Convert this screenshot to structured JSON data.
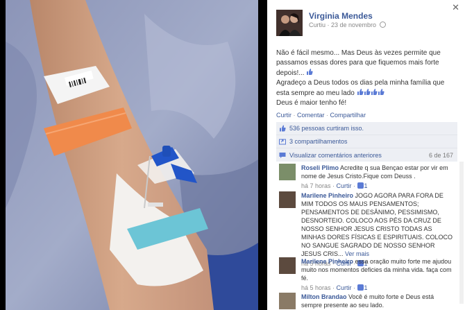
{
  "post": {
    "author": "Virginia Mendes",
    "meta": "Curtiu · 23 de novembro",
    "lines": [
      "Não é fácil mesmo... Mas Deus às vezes permite que passamos essas dores para que fiquemos mais forte depois!...",
      "Agradeço a Deus todos os dias pela minha família que esta sempre ao meu lado",
      "Deus é maior tenho fé!"
    ],
    "actions": {
      "like": "Curtir",
      "comment": "Comentar",
      "share": "Compartilhar"
    }
  },
  "ufi": {
    "likes": "536 pessoas curtiram isso.",
    "shares": "3 compartilhamentos",
    "view_previous": "Visualizar comentários anteriores",
    "count": "6 de 167"
  },
  "comments": [
    {
      "name": "Roseli Plimo",
      "text": "Acredite q sua Bençao estar por vir em nome de Jesus Cristo.Fique com Deuss .",
      "time": "há 7 horas",
      "like": "Curtir",
      "likes": "1"
    },
    {
      "name": "Marilene Pinheiro",
      "text": "JOGO AGORA PARA FORA DE MIM TODOS OS MAUS PENSAMENTOS; PENSAMENTOS DE DESÂNIMO, PESSIMISMO, DESNORTEIO. COLOCO AOS PÉS DA CRUZ DE NOSSO SENHOR JESUS CRISTO TODAS AS MINHAS DORES FÍSICAS E ESPIRITUAIS. COLOCO NO SANGUE SAGRADO DE NOSSO SENHOR JESUS CRIS...",
      "see_more": "Ver mais",
      "time": "há 5 horas",
      "like": "Curtir",
      "likes": "1"
    },
    {
      "name": "Marilene Pinheiro",
      "text": "essa oração muito forte me ajudou muito nos momentos deficies da minha vida. faça com fé.",
      "time": "há 5 horas",
      "like": "Curtir",
      "likes": "1"
    },
    {
      "name": "Milton Brandao",
      "text": "Você é muito forte e Deus está sempre presente ao seu lado.",
      "time": "",
      "like": "",
      "likes": ""
    }
  ],
  "colors": {
    "link": "#3b5998",
    "ufi_bg": "#edeff4",
    "wristband_orange": "#f08a4b",
    "cannula_blue": "#2255c8"
  },
  "icons": [
    "close-icon",
    "globe-icon",
    "thumbs-up-icon",
    "share-icon",
    "comment-icon"
  ]
}
